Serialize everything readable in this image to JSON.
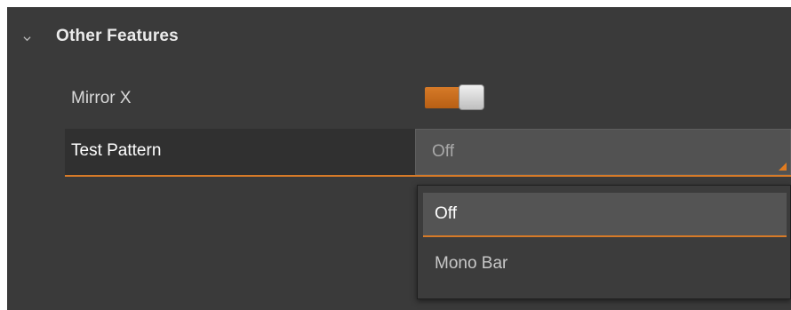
{
  "section": {
    "title": "Other Features",
    "expanded_icon": "chevron-down-icon"
  },
  "mirror_x": {
    "label": "Mirror X",
    "toggle_state": "on",
    "accent_color": "#d67a28"
  },
  "test_pattern": {
    "label": "Test Pattern",
    "selected_value": "Off",
    "dropdown_icon": "corner-triangle-icon",
    "options": [
      "Off",
      "Mono Bar"
    ],
    "highlighted_option": "Off"
  }
}
